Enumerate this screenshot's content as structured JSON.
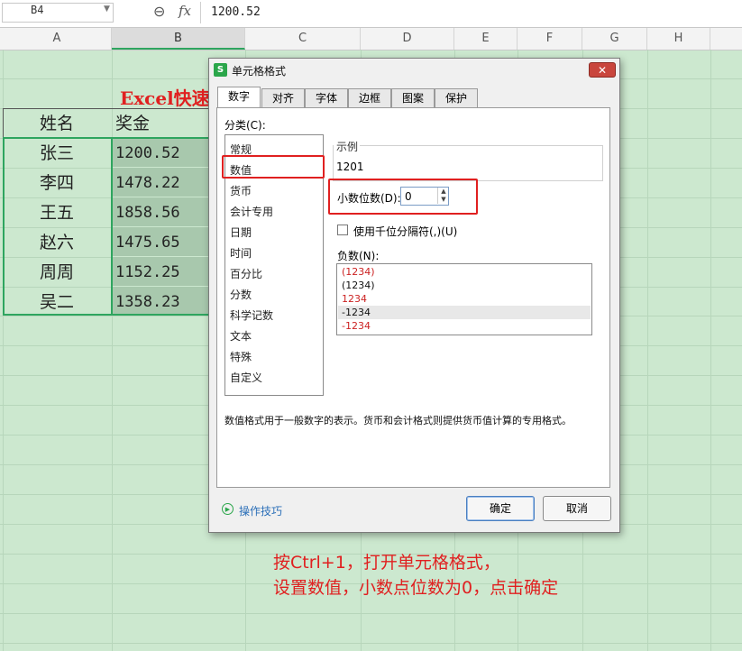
{
  "formula_bar": {
    "name_box": "B4",
    "zoom_icon": "zoom-icon",
    "fx_label": "fx",
    "value": "1200.52"
  },
  "columns": [
    "A",
    "B",
    "C",
    "D",
    "E",
    "F",
    "G",
    "H"
  ],
  "sheet": {
    "title": "Excel快速",
    "header": {
      "name": "姓名",
      "bonus": "奖金"
    },
    "rows": [
      {
        "name": "张三",
        "value": "1200.52"
      },
      {
        "name": "李四",
        "value": "1478.22"
      },
      {
        "name": "王五",
        "value": "1858.56"
      },
      {
        "name": "赵六",
        "value": "1475.65"
      },
      {
        "name": "周周",
        "value": "1152.25"
      },
      {
        "name": "吴二",
        "value": "1358.23"
      }
    ]
  },
  "dialog": {
    "logo": "S",
    "title": "单元格格式",
    "tabs": [
      "数字",
      "对齐",
      "字体",
      "边框",
      "图案",
      "保护"
    ],
    "category_label": "分类(C):",
    "categories": [
      "常规",
      "数值",
      "货币",
      "会计专用",
      "日期",
      "时间",
      "百分比",
      "分数",
      "科学记数",
      "文本",
      "特殊",
      "自定义"
    ],
    "sample_label": "示例",
    "sample_value": "1201",
    "decimal_label": "小数位数(D):",
    "decimal_value": "0",
    "thousand_label": "使用千位分隔符(,)(U)",
    "negative_label": "负数(N):",
    "negative_options": [
      "(1234)",
      "(1234)",
      "1234",
      "-1234",
      "-1234"
    ],
    "description": "数值格式用于一般数字的表示。货币和会计格式则提供货币值计算的专用格式。",
    "tips_link": "操作技巧",
    "ok_label": "确定",
    "cancel_label": "取消"
  },
  "instruction": {
    "line1": "按Ctrl+1，打开单元格格式，",
    "line2": "设置数值，小数点位数为0，点击确定"
  },
  "colors": {
    "accent_green": "#2ea55f",
    "highlight_red": "#e02020",
    "sheet_bg": "#cce8cf"
  }
}
